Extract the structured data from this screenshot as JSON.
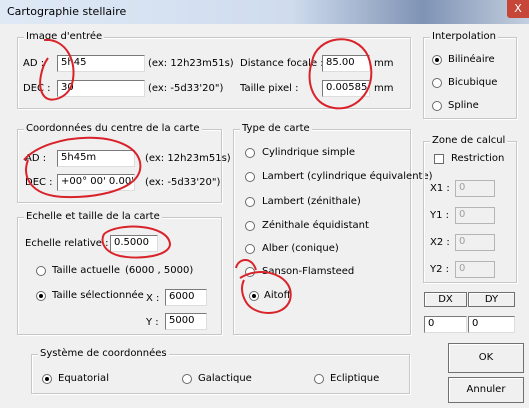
{
  "window": {
    "title": "Cartographie stellaire",
    "close": "X"
  },
  "image_entree": {
    "legend": "Image d'entrée",
    "ad_label": "AD :",
    "ad_value": "5h45",
    "ad_hint": "(ex: 12h23m51s)",
    "dec_label": "DEC :",
    "dec_value": "30",
    "dec_hint": "(ex: -5d33'20\")",
    "focal_label": "Distance focale :",
    "focal_value": "85.00",
    "focal_unit": "mm",
    "pixel_label": "Taille pixel :",
    "pixel_value": "0.00585",
    "pixel_unit": "mm"
  },
  "interpolation": {
    "legend": "Interpolation",
    "options": [
      {
        "label": "Bilinéaire",
        "selected": true
      },
      {
        "label": "Bicubique",
        "selected": false
      },
      {
        "label": "Spline",
        "selected": false
      }
    ]
  },
  "centre": {
    "legend": "Coordonnées du centre de la carte",
    "ad_label": "AD :",
    "ad_value": "5h45m",
    "ad_hint": "(ex: 12h23m51s)",
    "dec_label": "DEC :",
    "dec_value": "+00° 00' 0.00\"",
    "dec_hint": "(ex: -5d33'20\")"
  },
  "echelle": {
    "legend": "Echelle et taille de la carte",
    "relative_label": "Echelle relative :",
    "relative_value": "0.5000",
    "actuelle_label": "Taille actuelle",
    "actuelle_size": "(6000 , 5000)",
    "selection_label": "Taille sélectionnée",
    "x_label": "X :",
    "x_value": "6000",
    "y_label": "Y :",
    "y_value": "5000"
  },
  "type_carte": {
    "legend": "Type de carte",
    "options": [
      {
        "label": "Cylindrique simple",
        "selected": false
      },
      {
        "label": "Lambert (cylindrique équivalente)",
        "selected": false
      },
      {
        "label": "Lambert (zénithale)",
        "selected": false
      },
      {
        "label": "Zénithale équidistant",
        "selected": false
      },
      {
        "label": "Alber (conique)",
        "selected": false
      },
      {
        "label": "Sanson-Flamsteed",
        "selected": false
      },
      {
        "label": "Aitoff",
        "selected": true
      }
    ]
  },
  "zone_calcul": {
    "legend": "Zone de calcul",
    "restriction_label": "Restriction",
    "x1_label": "X1 :",
    "x1_value": "0",
    "y1_label": "Y1 :",
    "y1_value": "0",
    "x2_label": "X2 :",
    "x2_value": "0",
    "y2_label": "Y2 :",
    "y2_value": "0"
  },
  "offsets": {
    "dx_label": "DX",
    "dy_label": "DY",
    "dx_value": "0",
    "dy_value": "0"
  },
  "systeme": {
    "legend": "Système de coordonnées",
    "options": [
      {
        "label": "Equatorial",
        "selected": true
      },
      {
        "label": "Galactique",
        "selected": false
      },
      {
        "label": "Ecliptique",
        "selected": false
      }
    ]
  },
  "buttons": {
    "ok": "OK",
    "cancel": "Annuler"
  },
  "annotation_color": "#d9232a"
}
